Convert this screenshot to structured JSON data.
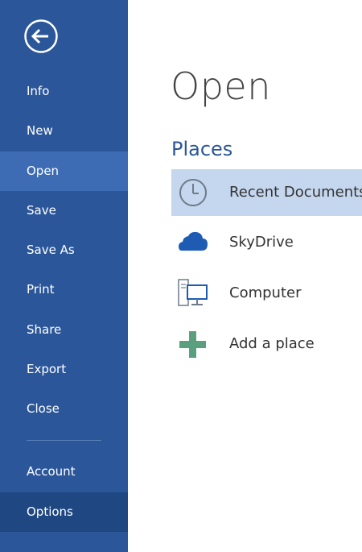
{
  "sidebar": {
    "items": [
      {
        "label": "Info"
      },
      {
        "label": "New"
      },
      {
        "label": "Open"
      },
      {
        "label": "Save"
      },
      {
        "label": "Save As"
      },
      {
        "label": "Print"
      },
      {
        "label": "Share"
      },
      {
        "label": "Export"
      },
      {
        "label": "Close"
      },
      {
        "label": "Account"
      },
      {
        "label": "Options"
      }
    ],
    "active_item": "Open"
  },
  "main": {
    "title": "Open",
    "section_title": "Places",
    "places": [
      {
        "label": "Recent Documents",
        "icon": "clock-icon",
        "selected": true
      },
      {
        "label": "SkyDrive",
        "icon": "cloud-icon"
      },
      {
        "label": "Computer",
        "icon": "computer-icon"
      },
      {
        "label": "Add a place",
        "icon": "plus-icon"
      }
    ]
  },
  "colors": {
    "sidebar_bg": "#2b579a",
    "sidebar_active": "#3d6cb4",
    "accent": "#2b579a",
    "selected_place": "#c5d7ee",
    "plus_green": "#5aa07f"
  }
}
